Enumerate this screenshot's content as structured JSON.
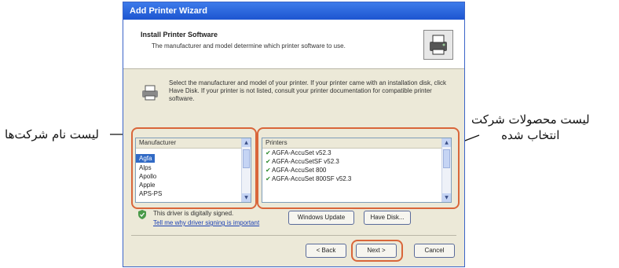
{
  "annotations": {
    "left_label": "لیست نام  شرکت‌ها",
    "right_label_line1": "لیست محصولات  شرکت",
    "right_label_line2": "انتخاب شده"
  },
  "window": {
    "title": "Add Printer Wizard"
  },
  "header": {
    "title": "Install Printer Software",
    "subtitle": "The manufacturer and model determine which printer software to use."
  },
  "info_text": "Select the manufacturer and model of your printer. If your printer came with an installation disk, click Have Disk. If your printer is not listed, consult your printer documentation for compatible printer software.",
  "manufacturer_list": {
    "header": "Manufacturer",
    "items": [
      "Agfa",
      "Alps",
      "Apollo",
      "Apple",
      "APS-PS"
    ],
    "selected_index": 0
  },
  "printers_list": {
    "header": "Printers",
    "items": [
      "AGFA-AccuSet v52.3",
      "AGFA-AccuSetSF v52.3",
      "AGFA-AccuSet 800",
      "AGFA-AccuSet 800SF v52.3"
    ]
  },
  "signed": {
    "text": "This driver is digitally signed.",
    "link": "Tell me why driver signing is important"
  },
  "buttons": {
    "windows_update": "Windows Update",
    "have_disk": "Have Disk...",
    "back": "< Back",
    "next": "Next >",
    "cancel": "Cancel"
  },
  "colors": {
    "highlight": "#d9663a",
    "selection": "#316ac5",
    "titlebar": "#1d55d0"
  }
}
